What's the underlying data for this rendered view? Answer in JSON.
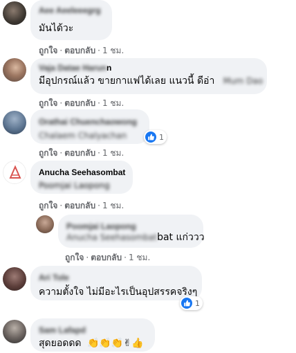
{
  "colors": {
    "like_blue": "#1877f2",
    "bubble": "#f0f2f5",
    "meta": "#65676b"
  },
  "comments": [
    {
      "author": "Aee Aeeleeegrg",
      "text": "มันได้วะ",
      "actions": {
        "like": "ถูกใจ",
        "reply": "ตอบกลับ",
        "time": "1 ชม."
      }
    },
    {
      "author": "Vaja Datae Harun",
      "author_tail": "n",
      "text": "มีอุปกรณ์แล้ว ขายกาแฟได้เลย แนวนี้ ดีอ่า",
      "text_tail": "Mum Dao",
      "actions": {
        "like": "ถูกใจ",
        "reply": "ตอบกลับ",
        "time": "1 ชม."
      }
    },
    {
      "author": "Orathai Chuenchaowong",
      "text_blur": "Chalaem Chalyachan",
      "reaction": {
        "icon": "thumbs-up-icon",
        "count": "1"
      },
      "actions": {
        "like": "ถูกใจ",
        "reply": "ตอบกลับ",
        "time": "1 ชม."
      }
    },
    {
      "author": "Anucha Seehasombat",
      "text_blur": "Poomjai Laopong",
      "actions": {
        "like": "ถูกใจ",
        "reply": "ตอบกลับ",
        "time": "1 ชม."
      }
    },
    {
      "author": "Poomjai Laopong",
      "text_blur": "Anucha Seehasombat",
      "text_visible": "bat แก่ววว",
      "actions": {
        "like": "ถูกใจ",
        "reply": "ตอบกลับ",
        "time": "1 ชม."
      }
    },
    {
      "author": "Ari Tole",
      "text": "ความตั้งใจ ไม่มีอะไรเป็นอุปสรรคจริงๆ",
      "reaction": {
        "icon": "thumbs-up-icon",
        "count": "1"
      },
      "actions": {
        "like": "ถูกใจ",
        "reply": "ตอบกลับ",
        "time": "1 ชม."
      }
    },
    {
      "author": "Sam Lafapd",
      "text": "สุดยอดดด",
      "emojis": "👏👏👏✌👍"
    }
  ]
}
